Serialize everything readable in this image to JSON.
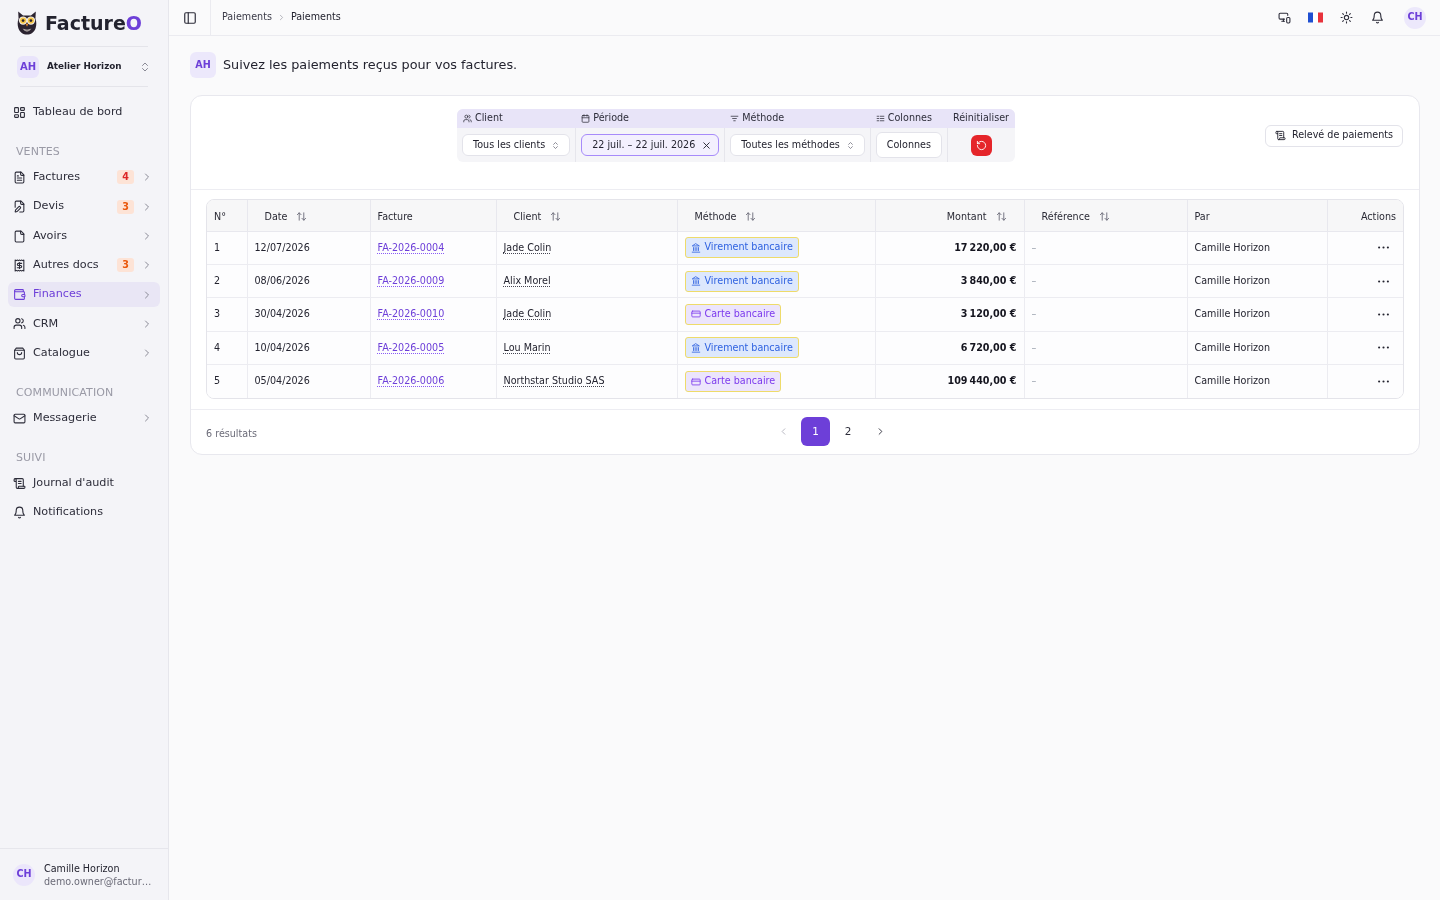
{
  "brand": {
    "name": "Facture",
    "accent": "O"
  },
  "workspace": {
    "initials": "AH",
    "name": "Atelier Horizon"
  },
  "sidebar": {
    "sections": [
      {
        "items": [
          {
            "label": "Tableau de bord",
            "selected": false,
            "expandable": false
          }
        ]
      },
      {
        "heading": "VENTES",
        "items": [
          {
            "label": "Factures",
            "badge": {
              "text": "4",
              "color": "#dc2626"
            },
            "selected": false,
            "expandable": true
          },
          {
            "label": "Devis",
            "badge": {
              "text": "3",
              "color": "#ea580c"
            },
            "selected": false,
            "expandable": true
          },
          {
            "label": "Avoirs",
            "selected": false,
            "expandable": true
          },
          {
            "label": "Autres docs",
            "badge": {
              "text": "3",
              "color": "#ea580c"
            },
            "selected": false,
            "expandable": true
          },
          {
            "label": "Finances",
            "selected": true,
            "expandable": true
          },
          {
            "label": "CRM",
            "selected": false,
            "expandable": true
          },
          {
            "label": "Catalogue",
            "selected": false,
            "expandable": true
          }
        ]
      },
      {
        "heading": "COMMUNICATION",
        "items": [
          {
            "label": "Messagerie",
            "selected": false,
            "expandable": true
          }
        ]
      },
      {
        "heading": "SUIVI",
        "items": [
          {
            "label": "Journal d'audit",
            "selected": false,
            "expandable": false
          },
          {
            "label": "Notifications",
            "selected": false,
            "expandable": false
          }
        ]
      }
    ]
  },
  "user": {
    "initials": "CH",
    "name": "Camille Horizon",
    "email": "demo.owner@factur…"
  },
  "topbar": {
    "breadcrumb": [
      "Paiements",
      "Paiements"
    ],
    "avatar": "CH"
  },
  "page": {
    "initials": "AH",
    "description": "Suivez les paiements reçus pour vos factures."
  },
  "filters": [
    {
      "kind": "select",
      "label": "Client",
      "value": "Tous les clients"
    },
    {
      "kind": "date_range",
      "label": "Période",
      "value": "22 juil. – 22 juil. 2026"
    },
    {
      "kind": "select",
      "label": "Méthode",
      "value": "Toutes les méthodes"
    },
    {
      "kind": "button",
      "label": "Colonnes",
      "value": "Colonnes"
    },
    {
      "kind": "reset",
      "label": "Réinitialiser"
    }
  ],
  "export_button": "Relevé de paiements",
  "table": {
    "columns": [
      {
        "label": "N°",
        "sortable": false
      },
      {
        "label": "Date",
        "sortable": true
      },
      {
        "label": "Facture",
        "sortable": false
      },
      {
        "label": "Client",
        "sortable": true
      },
      {
        "label": "Méthode",
        "sortable": true
      },
      {
        "label": "Montant",
        "sortable": true
      },
      {
        "label": "Référence",
        "sortable": true
      },
      {
        "label": "Par",
        "sortable": false
      },
      {
        "label": "Actions",
        "sortable": false
      }
    ],
    "rows": [
      {
        "no": "1",
        "date": "12/07/2026",
        "invoice": "FA-2026-0004",
        "client": "Jade Colin",
        "method": {
          "kind": "transfer",
          "label": "Virement bancaire"
        },
        "amount": "17 220,00 €",
        "reference": "–",
        "by": "Camille Horizon"
      },
      {
        "no": "2",
        "date": "08/06/2026",
        "invoice": "FA-2026-0009",
        "client": "Alix Morel",
        "method": {
          "kind": "transfer",
          "label": "Virement bancaire"
        },
        "amount": "3 840,00 €",
        "reference": "–",
        "by": "Camille Horizon"
      },
      {
        "no": "3",
        "date": "30/04/2026",
        "invoice": "FA-2026-0010",
        "client": "Jade Colin",
        "method": {
          "kind": "card",
          "label": "Carte bancaire"
        },
        "amount": "3 120,00 €",
        "reference": "–",
        "by": "Camille Horizon"
      },
      {
        "no": "4",
        "date": "10/04/2026",
        "invoice": "FA-2026-0005",
        "client": "Lou Marin",
        "method": {
          "kind": "transfer",
          "label": "Virement bancaire"
        },
        "amount": "6 720,00 €",
        "reference": "–",
        "by": "Camille Horizon"
      },
      {
        "no": "5",
        "date": "05/04/2026",
        "invoice": "FA-2026-0006",
        "client": "Northstar Studio SAS",
        "method": {
          "kind": "card",
          "label": "Carte bancaire"
        },
        "amount": "109 440,00 €",
        "reference": "–",
        "by": "Camille Horizon"
      }
    ]
  },
  "results": "6 résultats",
  "pagination": {
    "previous": {
      "disabled": true
    },
    "pages": [
      {
        "label": "1",
        "selected": true
      },
      {
        "label": "2",
        "selected": false
      }
    ],
    "next": {
      "disabled": false
    }
  }
}
